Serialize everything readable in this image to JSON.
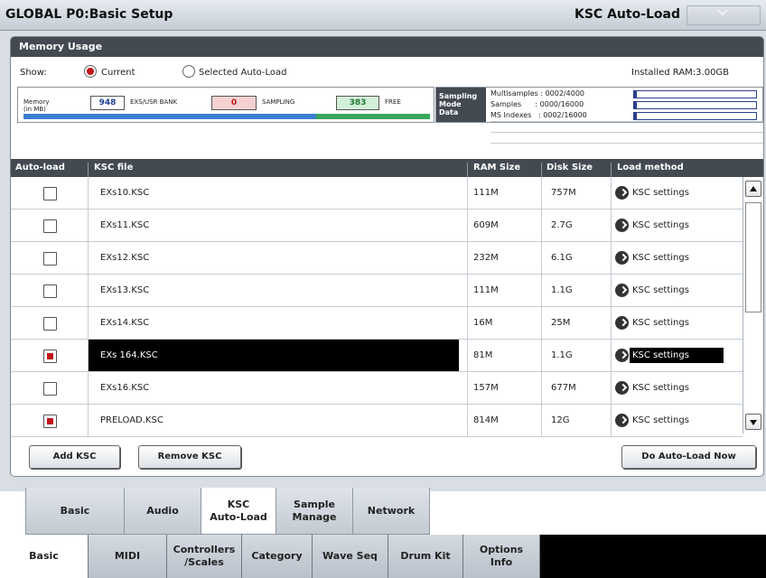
{
  "header": {
    "title": "GLOBAL P0:Basic Setup",
    "page_name": "KSC Auto-Load",
    "menu_icon": "chevron-down-icon"
  },
  "memory_usage": {
    "heading": "Memory Usage",
    "show_label": "Show:",
    "options": [
      "Current",
      "Selected Auto-Load"
    ],
    "selected_option": "Current",
    "installed_ram": "Installed RAM:3.00GB",
    "memory_label_line1": "Memory",
    "memory_label_line2": "(in MB)",
    "exs_usr_bank": "948",
    "exs_usr_bank_label": "EXS/USR BANK",
    "sampling": "0",
    "sampling_label": "SAMPLING",
    "free": "383",
    "free_label": "FREE",
    "colors": {
      "exs": "#3b7fd1",
      "free": "#3aa65a"
    }
  },
  "sampling_mode_data": {
    "label_line1": "Sampling",
    "label_line2": "Mode",
    "label_line3": "Data",
    "multisamples": "Multisamples : 0002/4000",
    "samples": "Samples      : 0000/16000",
    "ms_indexes": "MS Indexes   : 0002/16000"
  },
  "table": {
    "headers": [
      "Auto-load",
      "KSC file",
      "RAM Size",
      "Disk Size",
      "Load method"
    ],
    "rows": [
      {
        "checked": false,
        "file": "EXs10.KSC",
        "ram": "111M",
        "disk": "757M",
        "method": "KSC settings"
      },
      {
        "checked": false,
        "file": "EXs11.KSC",
        "ram": "609M",
        "disk": "2.7G",
        "method": "KSC settings"
      },
      {
        "checked": false,
        "file": "EXs12.KSC",
        "ram": "232M",
        "disk": "6.1G",
        "method": "KSC settings"
      },
      {
        "checked": false,
        "file": "EXs13.KSC",
        "ram": "111M",
        "disk": "1.1G",
        "method": "KSC settings"
      },
      {
        "checked": false,
        "file": "EXs14.KSC",
        "ram": "16M",
        "disk": "25M",
        "method": "KSC settings"
      },
      {
        "checked": true,
        "file": "EXs 164.KSC",
        "ram": "81M",
        "disk": "1.1G",
        "method": "KSC settings",
        "selected": true
      },
      {
        "checked": false,
        "file": "EXs16.KSC",
        "ram": "157M",
        "disk": "677M",
        "method": "KSC settings"
      },
      {
        "checked": true,
        "file": "PRELOAD.KSC",
        "ram": "814M",
        "disk": "12G",
        "method": "KSC settings"
      }
    ],
    "accent_color": "#c0141a"
  },
  "buttons": {
    "add": "Add KSC",
    "remove": "Remove KSC",
    "do_auto_load": "Do Auto-Load Now"
  },
  "sub_tabs": {
    "basic": "Basic",
    "audio": "Audio",
    "ksc_line1": "KSC",
    "ksc_line2": "Auto-Load",
    "sample_line1": "Sample",
    "sample_line2": "Manage",
    "network": "Network",
    "active": "KSC Auto-Load"
  },
  "main_tabs": {
    "basic": "Basic",
    "midi": "MIDI",
    "controllers_line1": "Controllers",
    "controllers_line2": "/Scales",
    "category": "Category",
    "wave_seq": "Wave Seq",
    "drum_kit": "Drum Kit",
    "options_line1": "Options",
    "options_line2": "Info",
    "active": "Basic"
  }
}
